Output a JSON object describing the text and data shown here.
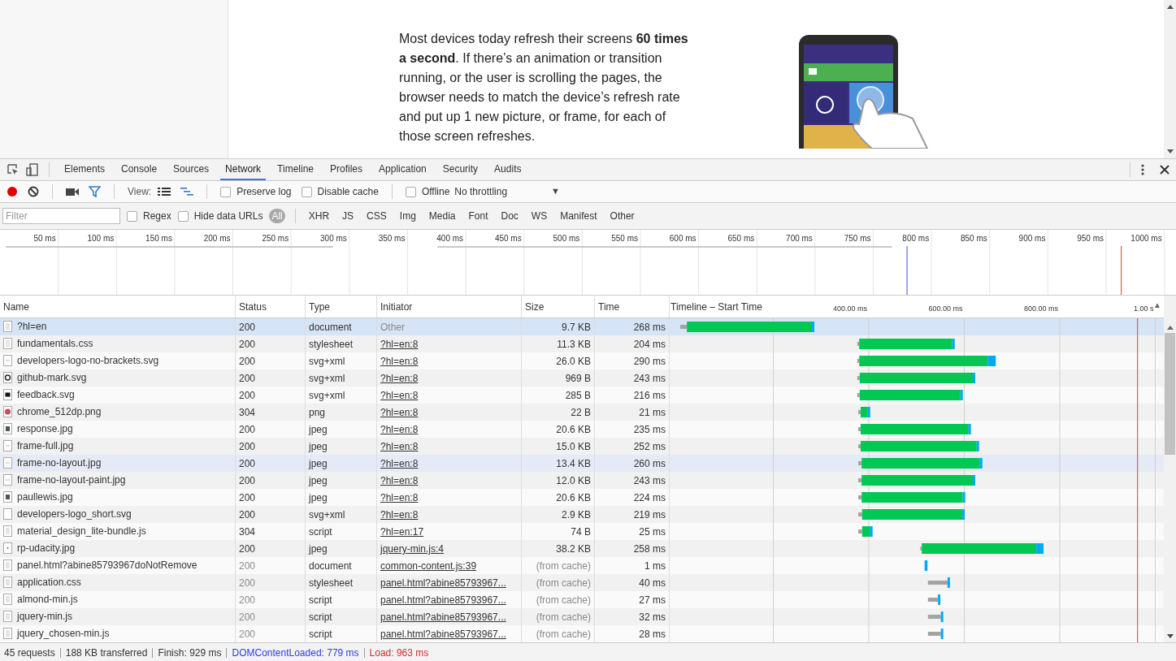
{
  "page": {
    "paragraph": "Most devices today refresh their screens **60 times a second**. If there’s an animation or transition running, or the user is scrolling the pages, the browser needs to match the device’s refresh rate and put up 1 new picture, or frame, for each of those screen refreshes."
  },
  "devtools": {
    "tabs": [
      {
        "label": "Elements",
        "selected": false
      },
      {
        "label": "Console",
        "selected": false
      },
      {
        "label": "Sources",
        "selected": false
      },
      {
        "label": "Network",
        "selected": true
      },
      {
        "label": "Timeline",
        "selected": false
      },
      {
        "label": "Profiles",
        "selected": false
      },
      {
        "label": "Application",
        "selected": false
      },
      {
        "label": "Security",
        "selected": false
      },
      {
        "label": "Audits",
        "selected": false
      }
    ]
  },
  "toolbar": {
    "record_on": true,
    "filter_on": true,
    "view_label": "View:",
    "views": [
      {
        "kind": "list",
        "selected": false
      },
      {
        "kind": "waterfall",
        "selected": true
      }
    ],
    "checkboxes": [
      {
        "label": "Preserve log",
        "checked": false
      },
      {
        "label": "Disable cache",
        "checked": false
      },
      {
        "label": "Offline",
        "checked": false
      }
    ],
    "throttling": "No throttling",
    "throttling_caret": "▼"
  },
  "filter_bar": {
    "placeholder": "Filter",
    "checkboxes": [
      {
        "label": "Regex",
        "checked": false
      },
      {
        "label": "Hide data URLs",
        "checked": false
      }
    ],
    "types": [
      {
        "label": "All",
        "selected": true
      },
      {
        "label": "XHR",
        "selected": false
      },
      {
        "label": "JS",
        "selected": false
      },
      {
        "label": "CSS",
        "selected": false
      },
      {
        "label": "Img",
        "selected": false
      },
      {
        "label": "Media",
        "selected": false
      },
      {
        "label": "Font",
        "selected": false
      },
      {
        "label": "Doc",
        "selected": false
      },
      {
        "label": "WS",
        "selected": false
      },
      {
        "label": "Manifest",
        "selected": false
      },
      {
        "label": "Other",
        "selected": false
      }
    ]
  },
  "overview": {
    "ticks": [
      "50 ms",
      "100 ms",
      "150 ms",
      "200 ms",
      "250 ms",
      "300 ms",
      "350 ms",
      "400 ms",
      "450 ms",
      "500 ms",
      "550 ms",
      "600 ms",
      "650 ms",
      "700 ms",
      "750 ms",
      "800 ms",
      "850 ms",
      "900 ms",
      "950 ms",
      "1000 ms"
    ]
  },
  "table": {
    "columns": [
      "Name",
      "Status",
      "Type",
      "Initiator",
      "Size",
      "Time"
    ],
    "rows": [
      {
        "name": "?hl=en",
        "status": "200",
        "type": "document",
        "initiator": "Other",
        "initiator_link": false,
        "size": "9.7 KB",
        "time": "268 ms",
        "selected": true,
        "hovered": false,
        "cached": false
      },
      {
        "name": "fundamentals.css",
        "status": "200",
        "type": "stylesheet",
        "initiator": "?hl=en:8",
        "initiator_link": true,
        "size": "11.3 KB",
        "time": "204 ms",
        "selected": false,
        "hovered": false,
        "cached": false
      },
      {
        "name": "developers-logo-no-brackets.svg",
        "status": "200",
        "type": "svg+xml",
        "initiator": "?hl=en:8",
        "initiator_link": true,
        "size": "26.0 KB",
        "time": "290 ms",
        "selected": false,
        "hovered": false,
        "cached": false
      },
      {
        "name": "github-mark.svg",
        "status": "200",
        "type": "svg+xml",
        "initiator": "?hl=en:8",
        "initiator_link": true,
        "size": "969 B",
        "time": "243 ms",
        "selected": false,
        "hovered": false,
        "cached": false
      },
      {
        "name": "feedback.svg",
        "status": "200",
        "type": "svg+xml",
        "initiator": "?hl=en:8",
        "initiator_link": true,
        "size": "285 B",
        "time": "216 ms",
        "selected": false,
        "hovered": false,
        "cached": false
      },
      {
        "name": "chrome_512dp.png",
        "status": "304",
        "type": "png",
        "initiator": "?hl=en:8",
        "initiator_link": true,
        "size": "22 B",
        "time": "21 ms",
        "selected": false,
        "hovered": false,
        "cached": false
      },
      {
        "name": "response.jpg",
        "status": "200",
        "type": "jpeg",
        "initiator": "?hl=en:8",
        "initiator_link": true,
        "size": "20.6 KB",
        "time": "235 ms",
        "selected": false,
        "hovered": false,
        "cached": false
      },
      {
        "name": "frame-full.jpg",
        "status": "200",
        "type": "jpeg",
        "initiator": "?hl=en:8",
        "initiator_link": true,
        "size": "15.0 KB",
        "time": "252 ms",
        "selected": false,
        "hovered": false,
        "cached": false
      },
      {
        "name": "frame-no-layout.jpg",
        "status": "200",
        "type": "jpeg",
        "initiator": "?hl=en:8",
        "initiator_link": true,
        "size": "13.4 KB",
        "time": "260 ms",
        "selected": false,
        "hovered": true,
        "cached": false
      },
      {
        "name": "frame-no-layout-paint.jpg",
        "status": "200",
        "type": "jpeg",
        "initiator": "?hl=en:8",
        "initiator_link": true,
        "size": "12.0 KB",
        "time": "243 ms",
        "selected": false,
        "hovered": false,
        "cached": false
      },
      {
        "name": "paullewis.jpg",
        "status": "200",
        "type": "jpeg",
        "initiator": "?hl=en:8",
        "initiator_link": true,
        "size": "20.6 KB",
        "time": "224 ms",
        "selected": false,
        "hovered": false,
        "cached": false
      },
      {
        "name": "developers-logo_short.svg",
        "status": "200",
        "type": "svg+xml",
        "initiator": "?hl=en:8",
        "initiator_link": true,
        "size": "2.9 KB",
        "time": "219 ms",
        "selected": false,
        "hovered": false,
        "cached": false
      },
      {
        "name": "material_design_lite-bundle.js",
        "status": "304",
        "type": "script",
        "initiator": "?hl=en:17",
        "initiator_link": true,
        "size": "74 B",
        "time": "25 ms",
        "selected": false,
        "hovered": false,
        "cached": false
      },
      {
        "name": "rp-udacity.jpg",
        "status": "200",
        "type": "jpeg",
        "initiator": "jquery-min.js:4",
        "initiator_link": true,
        "size": "38.2 KB",
        "time": "258 ms",
        "selected": false,
        "hovered": false,
        "cached": false
      },
      {
        "name": "panel.html?abine85793967doNotRemove",
        "status": "200",
        "type": "document",
        "initiator": "common-content.js:39",
        "initiator_link": true,
        "size": "(from cache)",
        "time": "1 ms",
        "selected": false,
        "hovered": false,
        "cached": true
      },
      {
        "name": "application.css",
        "status": "200",
        "type": "stylesheet",
        "initiator": "panel.html?abine85793967...",
        "initiator_link": true,
        "size": "(from cache)",
        "time": "40 ms",
        "selected": false,
        "hovered": false,
        "cached": true
      },
      {
        "name": "almond-min.js",
        "status": "200",
        "type": "script",
        "initiator": "panel.html?abine85793967...",
        "initiator_link": true,
        "size": "(from cache)",
        "time": "27 ms",
        "selected": false,
        "hovered": false,
        "cached": true
      },
      {
        "name": "jquery-min.js",
        "status": "200",
        "type": "script",
        "initiator": "panel.html?abine85793967...",
        "initiator_link": true,
        "size": "(from cache)",
        "time": "32 ms",
        "selected": false,
        "hovered": false,
        "cached": true
      },
      {
        "name": "jquery_chosen-min.js",
        "status": "200",
        "type": "script",
        "initiator": "panel.html?abine85793967...",
        "initiator_link": true,
        "size": "(from cache)",
        "time": "28 ms",
        "selected": false,
        "hovered": false,
        "cached": true
      }
    ],
    "waterfall": {
      "title": "Timeline – Start Time",
      "sort_arrow": "▲",
      "ticks": [
        "400.00 ms",
        "600.00 ms",
        "800.00 ms",
        "1.00 s"
      ]
    }
  },
  "status_bar": [
    {
      "text": "45 requests",
      "kind": "plain"
    },
    {
      "text": "188 KB transferred",
      "kind": "plain"
    },
    {
      "text": "Finish: 929 ms",
      "kind": "plain"
    },
    {
      "text": "DOMContentLoaded: 779 ms",
      "kind": "dom"
    },
    {
      "text": "Load: 963 ms",
      "kind": "load"
    }
  ]
}
